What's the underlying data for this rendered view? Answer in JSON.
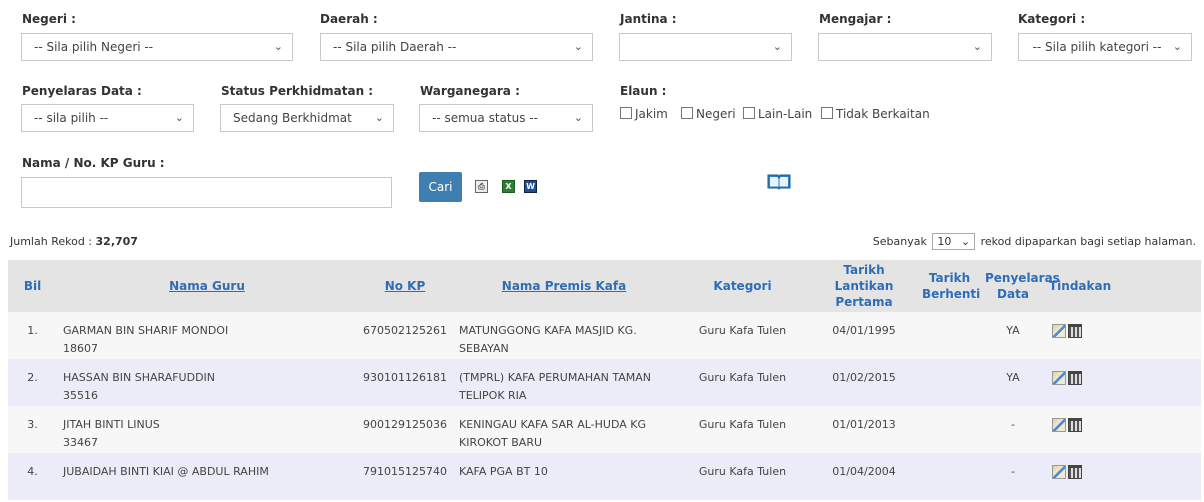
{
  "filters": {
    "negeri": {
      "label": "Negeri :",
      "value": "-- Sila pilih Negeri --"
    },
    "daerah": {
      "label": "Daerah :",
      "value": "-- Sila pilih Daerah --"
    },
    "jantina": {
      "label": "Jantina :",
      "value": ""
    },
    "mengajar": {
      "label": "Mengajar :",
      "value": ""
    },
    "kategori": {
      "label": "Kategori :",
      "value": "-- Sila pilih kategori --"
    },
    "penyelaras": {
      "label": "Penyelaras Data :",
      "value": "-- sila pilih --"
    },
    "status": {
      "label": "Status Perkhidmatan :",
      "value": "Sedang Berkhidmat"
    },
    "warganegara": {
      "label": "Warganegara :",
      "value": "-- semua status --"
    },
    "elaun": {
      "label": "Elaun :",
      "options": [
        "Jakim",
        "Negeri",
        "Lain-Lain",
        "Tidak Berkaitan"
      ]
    },
    "nama": {
      "label": "Nama / No. KP Guru :",
      "value": ""
    },
    "search_button": "Cari"
  },
  "icons": {
    "export_a": "print-icon",
    "export_b": "excel-icon",
    "export_c": "word-icon",
    "manual": "book-icon"
  },
  "summary": {
    "records_label": "Jumlah Rekod :",
    "records_value": "32,707",
    "per_page_prefix": "Sebanyak",
    "per_page_value": "10",
    "per_page_suffix": "rekod dipaparkan bagi setiap halaman."
  },
  "table": {
    "headers": {
      "bil": "Bil",
      "nama": "Nama Guru",
      "nokp": "No KP",
      "premis": "Nama Premis Kafa",
      "kategori": "Kategori",
      "lantikan": "Tarikh Lantikan Pertama",
      "berhenti": "Tarikh Berhenti",
      "penyelaras": "Penyelaras Data",
      "tindakan": "Tindakan"
    },
    "rows": [
      {
        "bil": "1.",
        "nama": "GARMAN BIN SHARIF MONDOI",
        "id": "18607",
        "nokp": "670502125261",
        "premis": "MATUNGGONG KAFA MASJID KG. SEBAYAN",
        "kategori": "Guru Kafa Tulen",
        "lantikan": "04/01/1995",
        "berhenti": "",
        "penyelaras": "YA"
      },
      {
        "bil": "2.",
        "nama": "HASSAN BIN SHARAFUDDIN",
        "id": "35516",
        "nokp": "930101126181",
        "premis": "(TMPRL) KAFA PERUMAHAN TAMAN TELIPOK RIA",
        "kategori": "Guru Kafa Tulen",
        "lantikan": "01/02/2015",
        "berhenti": "",
        "penyelaras": "YA"
      },
      {
        "bil": "3.",
        "nama": "JITAH BINTI LINUS",
        "id": "33467",
        "nokp": "900129125036",
        "premis": "KENINGAU KAFA SAR AL-HUDA KG KIROKOT BARU",
        "kategori": "Guru Kafa Tulen",
        "lantikan": "01/01/2013",
        "berhenti": "",
        "penyelaras": "-"
      },
      {
        "bil": "4.",
        "nama": "JUBAIDAH BINTI KIAI @ ABDUL RAHIM",
        "id": "",
        "nokp": "791015125740",
        "premis": "KAFA PGA BT 10",
        "kategori": "Guru Kafa Tulen",
        "lantikan": "01/04/2004",
        "berhenti": "",
        "penyelaras": "-"
      }
    ]
  }
}
